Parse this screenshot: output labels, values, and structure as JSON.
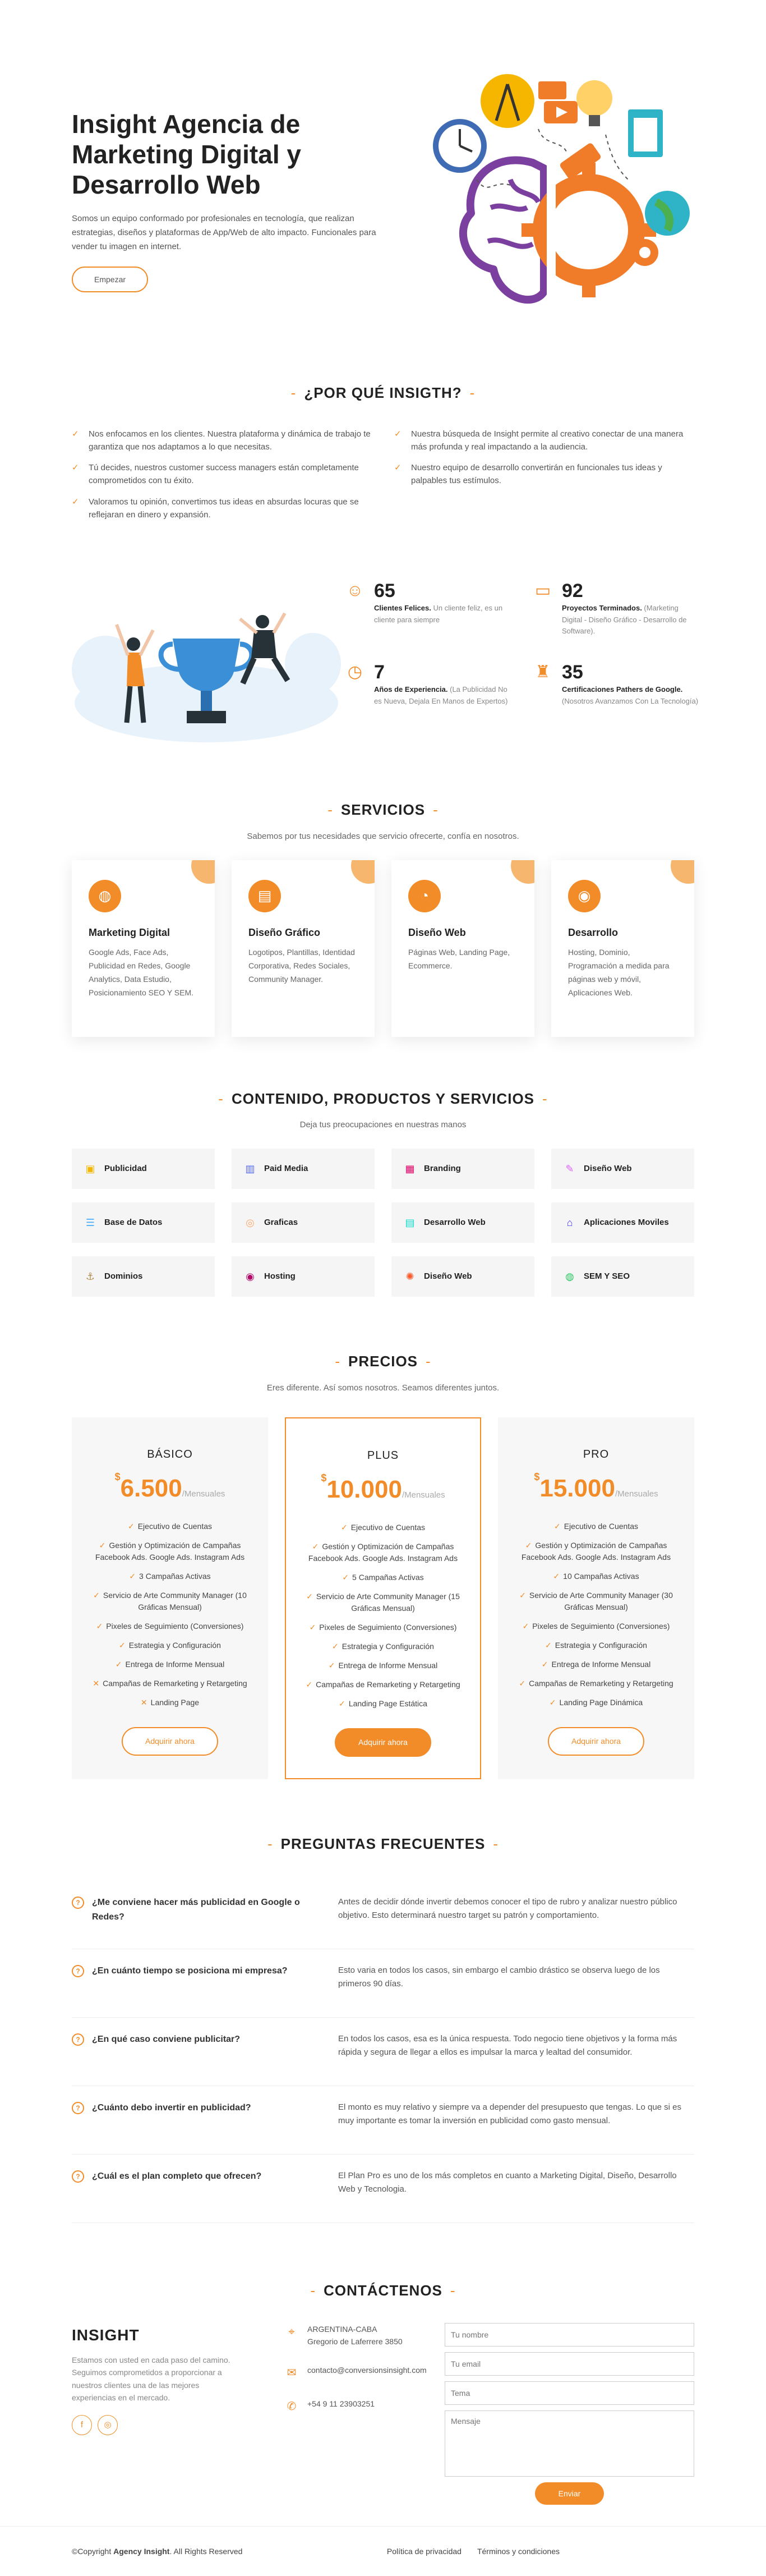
{
  "hero": {
    "title": "Insight Agencia de Marketing Digital y Desarrollo Web",
    "description": "Somos un equipo conformado por profesionales en tecnología, que realizan estrategias, diseños y plataformas de App/Web de alto impacto. Funcionales para vender tu imagen en internet.",
    "cta": "Empezar"
  },
  "why": {
    "title": "¿POR QUÉ INSIGTH?",
    "items": [
      "Nos enfocamos en los clientes. Nuestra plataforma y dinámica de trabajo te garantiza que nos adaptamos a lo que necesitas.",
      "Nuestra búsqueda de Insight permite al creativo conectar de una manera más profunda y real impactando a la audiencia.",
      "Tú decides, nuestros customer success managers están completamente comprometidos con tu éxito.",
      "Nuestro equipo de desarrollo convertirán en funcionales tus ideas y palpables tus estímulos.",
      "Valoramos tu opinión, convertimos tus ideas en absurdas locuras que se reflejaran en dinero y expansión."
    ]
  },
  "stats": [
    {
      "icon": "smile-icon",
      "number": "65",
      "label": "Clientes Felices.",
      "note": " Un cliente feliz, es un cliente para siempre"
    },
    {
      "icon": "folder-icon",
      "number": "92",
      "label": "Proyectos Terminados.",
      "note": " (Marketing Digital - Diseño Gráfico - Desarrollo de Software)."
    },
    {
      "icon": "clock-icon",
      "number": "7",
      "label": "Años de Experiencia.",
      "note": " (La Publicidad No es Nueva, Dejala En Manos de Expertos)"
    },
    {
      "icon": "trophy-icon",
      "number": "35",
      "label": "Certificaciones Pathers de Google.",
      "note": " (Nosotros Avanzamos Con La Tecnología)"
    }
  ],
  "services": {
    "title": "SERVICIOS",
    "subtitle": "Sabemos por tus necesidades que servicio ofrecerte, confía en nosotros.",
    "cards": [
      {
        "icon": "dribbble-icon",
        "title": "Marketing Digital",
        "desc": "Google Ads, Face Ads, Publicidad en Redes, Google Analytics, Data Estudio, Posicionamiento SEO Y SEM."
      },
      {
        "icon": "file-icon",
        "title": "Diseño Gráfico",
        "desc": "Logotipos, Plantillas, Identidad Corporativa, Redes Sociales, Community Manager."
      },
      {
        "icon": "speedometer-icon",
        "title": "Diseño Web",
        "desc": "Páginas Web, Landing Page, Ecommerce."
      },
      {
        "icon": "globe-icon",
        "title": "Desarrollo",
        "desc": "Hosting, Dominio, Programación a medida para páginas web y móvil, Aplicaciones Web."
      }
    ]
  },
  "content": {
    "title": "CONTENIDO, PRODUCTOS Y SERVICIOS",
    "subtitle": "Deja tus preocupaciones en nuestras manos",
    "tiles": [
      {
        "icon": "image-icon",
        "glyph": "▣",
        "color": "#f2b705",
        "label": "Publicidad"
      },
      {
        "icon": "bar-chart-icon",
        "glyph": "▥",
        "color": "#5468ff",
        "label": "Paid Media"
      },
      {
        "icon": "calendar-icon",
        "glyph": "▦",
        "color": "#e80368",
        "label": "Branding"
      },
      {
        "icon": "paint-brush-icon",
        "glyph": "✎",
        "color": "#e361ff",
        "label": "Diseño Web"
      },
      {
        "icon": "database-icon",
        "glyph": "☰",
        "color": "#47aeff",
        "label": "Base de Datos"
      },
      {
        "icon": "gradient-icon",
        "glyph": "◎",
        "color": "#ffa76e",
        "label": "Graficas"
      },
      {
        "icon": "file-list-icon",
        "glyph": "▤",
        "color": "#11dbcf",
        "label": "Desarrollo Web"
      },
      {
        "icon": "price-tag-icon",
        "glyph": "⌂",
        "color": "#4233ff",
        "label": "Aplicaciones Moviles"
      },
      {
        "icon": "anchor-icon",
        "glyph": "⚓",
        "color": "#b2904f",
        "label": "Dominios"
      },
      {
        "icon": "disc-icon",
        "glyph": "◉",
        "color": "#b20969",
        "label": "Hosting"
      },
      {
        "icon": "base-station-icon",
        "glyph": "✺",
        "color": "#ff5828",
        "label": "Diseño Web"
      },
      {
        "icon": "fingerprint-icon",
        "glyph": "◍",
        "color": "#29cc61",
        "label": "SEM Y SEO"
      }
    ]
  },
  "pricing": {
    "title": "PRECIOS",
    "subtitle": "Eres diferente. Así somos nosotros. Seamos diferentes juntos.",
    "plans": [
      {
        "name": "BÁSICO",
        "currency": "$",
        "price": "6.500",
        "period": "/Mensuales",
        "button": "Adquirir ahora",
        "features": [
          {
            "text": "Ejecutivo de Cuentas",
            "included": true
          },
          {
            "text": "Gestión y Optimización de Campañas Facebook Ads. Google Ads. Instagram Ads",
            "included": true
          },
          {
            "text": "3 Campañas Activas",
            "included": true
          },
          {
            "text": "Servicio de Arte Community Manager (10 Gráficas Mensual)",
            "included": true
          },
          {
            "text": "Pixeles de Seguimiento (Conversiones)",
            "included": true
          },
          {
            "text": "Estrategia y Configuración",
            "included": true
          },
          {
            "text": "Entrega de Informe Mensual",
            "included": true
          },
          {
            "text": "Campañas de Remarketing y Retargeting",
            "included": false
          },
          {
            "text": "Landing Page",
            "included": false
          }
        ]
      },
      {
        "name": "PLUS",
        "currency": "$",
        "price": "10.000",
        "period": "/Mensuales",
        "button": "Adquirir ahora",
        "features": [
          {
            "text": "Ejecutivo de Cuentas",
            "included": true
          },
          {
            "text": "Gestión y Optimización de Campañas Facebook Ads. Google Ads. Instagram Ads",
            "included": true
          },
          {
            "text": "5 Campañas Activas",
            "included": true
          },
          {
            "text": "Servicio de Arte Community Manager (15 Gráficas Mensual)",
            "included": true
          },
          {
            "text": "Pixeles de Seguimiento (Conversiones)",
            "included": true
          },
          {
            "text": "Estrategia y Configuración",
            "included": true
          },
          {
            "text": "Entrega de Informe Mensual",
            "included": true
          },
          {
            "text": "Campañas de Remarketing y Retargeting",
            "included": true
          },
          {
            "text": "Landing Page Estática",
            "included": true
          }
        ]
      },
      {
        "name": "PRO",
        "currency": "$",
        "price": "15.000",
        "period": "/Mensuales",
        "button": "Adquirir ahora",
        "features": [
          {
            "text": "Ejecutivo de Cuentas",
            "included": true
          },
          {
            "text": "Gestión y Optimización de Campañas Facebook Ads. Google Ads. Instagram Ads",
            "included": true
          },
          {
            "text": "10 Campañas Activas",
            "included": true
          },
          {
            "text": "Servicio de Arte Community Manager (30 Gráficas Mensual)",
            "included": true
          },
          {
            "text": "Pixeles de Seguimiento (Conversiones)",
            "included": true
          },
          {
            "text": "Estrategia y Configuración",
            "included": true
          },
          {
            "text": "Entrega de Informe Mensual",
            "included": true
          },
          {
            "text": "Campañas de Remarketing y Retargeting",
            "included": true
          },
          {
            "text": "Landing Page Dinámica",
            "included": true
          }
        ]
      }
    ]
  },
  "faq": {
    "title": "PREGUNTAS FRECUENTES",
    "items": [
      {
        "q": "¿Me conviene hacer más publicidad en Google o Redes?",
        "a": "Antes de decidir dónde invertir debemos conocer el tipo de rubro y analizar nuestro público objetivo. Esto determinará nuestro target su patrón y comportamiento."
      },
      {
        "q": "¿En cuánto tiempo se posiciona mi empresa?",
        "a": "Esto varia en todos los casos, sin embargo el cambio drástico se observa luego de los primeros 90 días."
      },
      {
        "q": "¿En qué caso conviene publicitar?",
        "a": "En todos los casos, esa es la única respuesta. Todo negocio tiene objetivos y la forma más rápida y segura de llegar a ellos es impulsar la marca y lealtad del consumidor."
      },
      {
        "q": "¿Cuánto debo invertir en publicidad?",
        "a": "El monto es muy relativo y siempre va a depender del presupuesto que tengas. Lo que si es muy importante es tomar la inversión en publicidad como gasto mensual."
      },
      {
        "q": "¿Cuál es el plan completo que ofrecen?",
        "a": "El Plan Pro es uno de los más completos en cuanto a Marketing Digital, Diseño, Desarrollo Web y Tecnologia."
      }
    ]
  },
  "contact": {
    "title": "CONTÁCTENOS",
    "brand": "INSIGHT",
    "brand_desc": "Estamos con usted en cada paso del camino. Seguimos comprometidos a proporcionar a nuestros clientes una de las mejores experiencias en el mercado.",
    "address_line1": "ARGENTINA-CABA",
    "address_line2": "Gregorio de Laferrere 3850",
    "email": "contacto@conversionsinsight.com",
    "phone": "+54 9 11 23903251",
    "form": {
      "name_placeholder": "Tu nombre",
      "email_placeholder": "Tu email",
      "subject_placeholder": "Tema",
      "message_placeholder": "Mensaje",
      "submit": "Enviar"
    }
  },
  "footer": {
    "copyright_prefix": "©Copyright ",
    "brand": "Agency Insight",
    "copyright_suffix": ". All Rights Reserved",
    "links": [
      "Política de privacidad",
      "Términos y condiciones"
    ]
  },
  "colors": {
    "accent": "#f28c28",
    "accent_light": "#f6b66e",
    "brain_purple": "#7b3fa0",
    "trophy_blue": "#3a8fd6"
  }
}
